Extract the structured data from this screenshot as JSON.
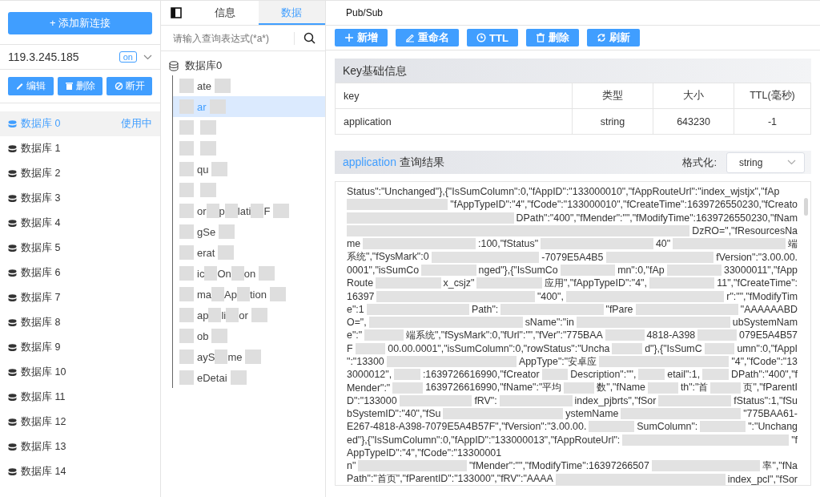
{
  "sidebar": {
    "add_button": "+ 添加新连接",
    "connection": {
      "host": "119.3.245.185",
      "status": "on",
      "expanded": false
    },
    "actions": [
      "编辑",
      "删除",
      "断开"
    ],
    "databases": [
      {
        "name": "数据库 0",
        "selected": true,
        "badge": "使用中"
      },
      {
        "name": "数据库 1",
        "selected": false
      },
      {
        "name": "数据库 2",
        "selected": false
      },
      {
        "name": "数据库 3",
        "selected": false
      },
      {
        "name": "数据库 4",
        "selected": false
      },
      {
        "name": "数据库 5",
        "selected": false
      },
      {
        "name": "数据库 6",
        "selected": false
      },
      {
        "name": "数据库 7",
        "selected": false
      },
      {
        "name": "数据库 8",
        "selected": false
      },
      {
        "name": "数据库 9",
        "selected": false
      },
      {
        "name": "数据库 10",
        "selected": false
      },
      {
        "name": "数据库 11",
        "selected": false
      },
      {
        "name": "数据库 12",
        "selected": false
      },
      {
        "name": "数据库 13",
        "selected": false
      },
      {
        "name": "数据库 14",
        "selected": false
      }
    ]
  },
  "key_panel": {
    "tabs": [
      {
        "label": "信息",
        "selected": false
      },
      {
        "label": "数据",
        "selected": true
      }
    ],
    "search": {
      "placeholder": "请输入查询表达式(*a*)"
    },
    "tree": {
      "label": "数据库0",
      "children": [
        {
          "fragments": [
            "ate"
          ],
          "selected": false
        },
        {
          "fragments": [
            "ar"
          ],
          "selected": true
        },
        {
          "selected": false
        },
        {
          "selected": false
        },
        {
          "fragments": [
            "qu"
          ],
          "selected": false
        },
        {
          "selected": false
        },
        {
          "fragments": [
            "or",
            "p",
            "lati",
            "F"
          ],
          "selected": false
        },
        {
          "fragments": [
            "gSe"
          ],
          "selected": false
        },
        {
          "fragments": [
            "erat"
          ],
          "selected": false
        },
        {
          "fragments": [
            "ic",
            "On",
            "on"
          ],
          "selected": false
        },
        {
          "fragments": [
            "ma",
            "Ap",
            "tion"
          ],
          "selected": false
        },
        {
          "fragments": [
            "ap",
            "li",
            "or"
          ],
          "selected": false
        },
        {
          "fragments": [
            "ob"
          ],
          "selected": false
        },
        {
          "fragments": [
            "ayS",
            "me"
          ],
          "selected": false
        },
        {
          "fragments": [
            "eDetai"
          ],
          "selected": false
        }
      ]
    }
  },
  "main": {
    "top_tab": "Pub/Sub",
    "toolbar": [
      "新增",
      "重命名",
      "TTL",
      "删除",
      "刷新"
    ],
    "key_info": {
      "title": "Key基础信息",
      "columns": [
        "key",
        "类型",
        "大小",
        "TTL(毫秒)"
      ],
      "row": [
        "application",
        "string",
        "643230",
        "-1"
      ]
    },
    "result": {
      "key": "application",
      "title": "查询结果",
      "format_label": "格式化:",
      "format_value": "string",
      "lines": [
        {
          "fragments": [
            "Status\":\"Unchanged\"},{\"IsSumColumn\":0,\"fAppID\":\"133000010\",\"fAppRouteUrl\":\"index_wjstjx\",\"fAp"
          ]
        },
        {
          "lead_hidden": true,
          "fragments": [
            "\"fAppTypeID\":\"4\",\"fCode\":\"133000010\",\"fCreateTime\":1639726550230,\"fCreato"
          ]
        },
        {
          "lead_hidden": true,
          "fragments": [
            "DPath\":\"400\",\"fMender\":\"\",\"fModifyTime\":1639726550230,\"fNam"
          ]
        },
        {
          "lead_hidden": true,
          "fragments": [
            "DzRO=\",\"fResourcesNa"
          ]
        },
        {
          "fragments": [
            "me",
            ":100,\"fStatus\"",
            "40\"",
            "端"
          ]
        },
        {
          "fragments": [
            "系统\",\"fSysMark\":0",
            "-7079E5A4B5",
            "fVersion\":\"3.00.00."
          ]
        },
        {
          "fragments": [
            "0001\",\"isSumCo",
            "nged\"},{\"IsSumCo",
            "mn\":0,\"fAp",
            "33000011\",\"fApp"
          ]
        },
        {
          "fragments": [
            "Route",
            "x_csjz\"",
            "应用\",\"fAppTypeID\":\"4\",",
            "11\",\"fCreateTime\":"
          ]
        },
        {
          "fragments": [
            "16397",
            "\"400\",",
            "r\":\"\",\"fModifyTim"
          ]
        },
        {
          "fragments": [
            "e\":1",
            "Path\":",
            "\"fPare",
            "\"AAAAAABD"
          ]
        },
        {
          "fragments": [
            "O=\",",
            "sName\":\"in",
            "ubSystemNam"
          ]
        },
        {
          "fragments": [
            "e\":\"",
            "端系统\",\"fSysMark\":0,\"fUrl\":\"\",\"fVer\":\"775BAA",
            "4818-A398",
            "079E5A4B57"
          ]
        },
        {
          "fragments": [
            "F",
            "00.00.0001\",\"isSumColumn\":0,\"rowStatus\":\"Uncha",
            "d\"},{\"IsSumC",
            "umn\":0,\"fAppI"
          ]
        },
        {
          "fragments": [
            "\":\"13300",
            "AppType\":\"安卓应",
            "\"4\",\"fCode\":\"13"
          ]
        },
        {
          "fragments": [
            "3000012\",",
            ":1639726616990,\"fCreator",
            "Description\":\"\",",
            "etail\":1,",
            "DPath\":\"400\",\"f"
          ]
        },
        {
          "fragments": [
            "Mender\":\"",
            "1639726616990,\"fName\":\"平均",
            "数\",\"fName",
            "th\":\"首",
            "页\",\"fParentI"
          ]
        },
        {
          "fragments": [
            "D\":\"133000",
            "fRV\":",
            "index_pjbrts\",\"fSor",
            "fStatus\":1,\"fSu"
          ]
        },
        {
          "fragments": [
            "bSystemID\":\"40\",\"fSu",
            "ystemName",
            "\"775BAA61-"
          ]
        },
        {
          "fragments": [
            "E267-4818-A398-7079E5A4B57F\",\"fVersion\":\"3.00.00.",
            "SumColumn\":",
            "\":\"Unchang"
          ]
        },
        {
          "fragments": [
            "ed\"},{\"IsSumColumn\":0,\"fAppID\":\"133000013\",\"fAppRouteUrl\":",
            "\"f"
          ]
        },
        {
          "fragments": [
            "AppTypeID\":\"4\",\"fCode\":\"13300001"
          ]
        },
        {
          "fragments": [
            "n\"",
            "\"fMender\":\"\",\"fModifyTime\":16397266507",
            "率\",\"fNa"
          ]
        },
        {
          "fragments": [
            "Path\":\"首页\",\"fParentID\":\"133000\",\"fRV\":\"AAAA",
            "index_pcl\",\"fSor"
          ]
        }
      ]
    }
  }
}
